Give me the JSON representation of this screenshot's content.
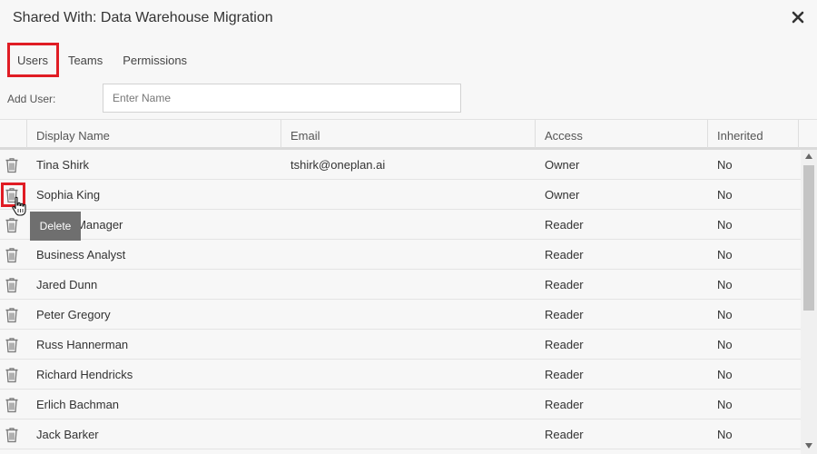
{
  "dialog": {
    "title": "Shared With: Data Warehouse Migration",
    "close_icon": "close-icon"
  },
  "tabs": [
    {
      "label": "Users",
      "active": true
    },
    {
      "label": "Teams",
      "active": false
    },
    {
      "label": "Permissions",
      "active": false
    }
  ],
  "add_user": {
    "label": "Add User:",
    "placeholder": "Enter Name",
    "value": ""
  },
  "grid": {
    "headers": {
      "display_name": "Display Name",
      "email": "Email",
      "access": "Access",
      "inherited": "Inherited"
    },
    "rows": [
      {
        "name": "Tina Shirk",
        "email": "tshirk@oneplan.ai",
        "access": "Owner",
        "inherited": "No"
      },
      {
        "name": "Sophia King",
        "email": "",
        "access": "Owner",
        "inherited": "No"
      },
      {
        "name": "Project Manager",
        "email": "",
        "access": "Reader",
        "inherited": "No"
      },
      {
        "name": "Business Analyst",
        "email": "",
        "access": "Reader",
        "inherited": "No"
      },
      {
        "name": "Jared Dunn",
        "email": "",
        "access": "Reader",
        "inherited": "No"
      },
      {
        "name": "Peter Gregory",
        "email": "",
        "access": "Reader",
        "inherited": "No"
      },
      {
        "name": "Russ Hannerman",
        "email": "",
        "access": "Reader",
        "inherited": "No"
      },
      {
        "name": "Richard Hendricks",
        "email": "",
        "access": "Reader",
        "inherited": "No"
      },
      {
        "name": "Erlich Bachman",
        "email": "",
        "access": "Reader",
        "inherited": "No"
      },
      {
        "name": "Jack Barker",
        "email": "",
        "access": "Reader",
        "inherited": "No"
      }
    ],
    "row_icon": "trash-icon"
  },
  "tooltip": {
    "text": "Delete"
  },
  "colors": {
    "highlight": "#e01c24",
    "background": "#f7f7f7",
    "tooltip_bg": "#6f6f6f"
  }
}
